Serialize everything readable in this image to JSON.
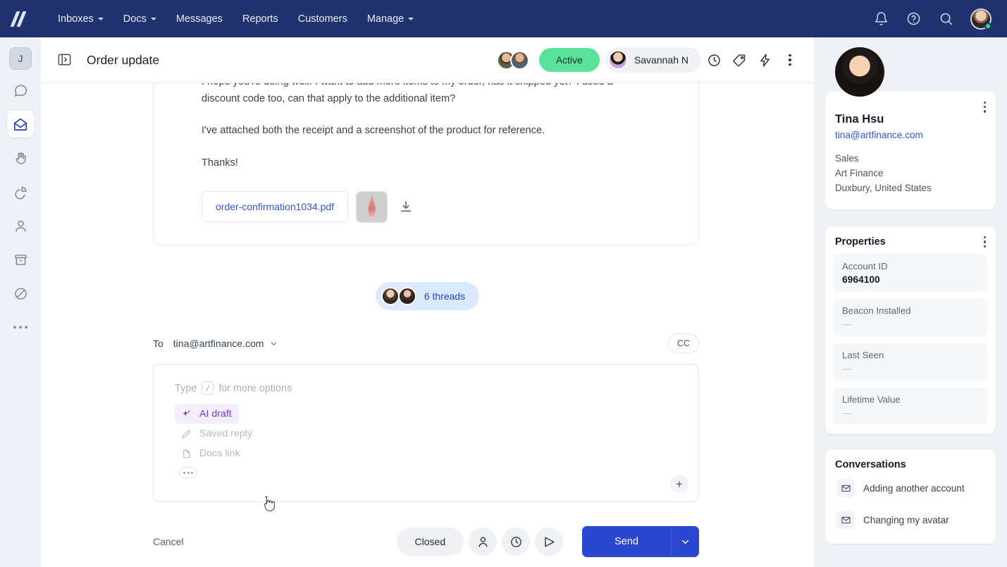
{
  "topnav": {
    "logo": "helpscout-logo",
    "items": [
      {
        "label": "Inboxes",
        "caret": true
      },
      {
        "label": "Docs",
        "caret": true
      },
      {
        "label": "Messages",
        "caret": false
      },
      {
        "label": "Reports",
        "caret": false
      },
      {
        "label": "Customers",
        "caret": false
      },
      {
        "label": "Manage",
        "caret": true
      }
    ],
    "icons": [
      "bell-icon",
      "help-circle-icon",
      "search-icon"
    ],
    "avatar_status": "online"
  },
  "rail": {
    "avatar_initial": "J",
    "items": [
      {
        "icon": "chat-bubble-icon",
        "active": false
      },
      {
        "icon": "open-envelope-icon",
        "active": true
      },
      {
        "icon": "raised-hand-icon",
        "active": false
      },
      {
        "icon": "pie-chart-icon",
        "active": false
      },
      {
        "icon": "person-icon",
        "active": false
      },
      {
        "icon": "archive-box-icon",
        "active": false
      },
      {
        "icon": "circle-slash-icon",
        "active": false
      }
    ],
    "more": "more-icon"
  },
  "subheader": {
    "toggle_icon": "panel-toggle-icon",
    "title": "Order update",
    "status_label": "Active",
    "assignee": "Savannah N",
    "icons": [
      "clock-icon",
      "tag-icon",
      "lightning-icon",
      "kebab-icon"
    ]
  },
  "message": {
    "paragraphs": [
      "I hope you're doing well. I want to add more items to my order, has it shipped yet? I used a discount code too, can that apply to the additional item?",
      "I've attached both the receipt and a screenshot of the product for reference.",
      "Thanks!"
    ],
    "attachment_name": "order-confirmation1034.pdf",
    "thumbnail": "product-screenshot-thumbnail",
    "download_icon": "download-icon"
  },
  "threads": {
    "label": "6 threads"
  },
  "compose": {
    "to_label": "To",
    "to_value": "tina@artfinance.com",
    "cc_label": "CC",
    "placeholder_prefix": "Type",
    "placeholder_key": "/",
    "placeholder_suffix": "for more options",
    "options": [
      {
        "label": "AI draft",
        "icon": "sparkle-icon",
        "highlighted": true
      },
      {
        "label": "Saved reply",
        "icon": "pen-icon",
        "highlighted": false
      },
      {
        "label": "Docs link",
        "icon": "document-icon",
        "highlighted": false
      }
    ],
    "more_icon": "ellipsis-icon",
    "add_icon": "plus-icon"
  },
  "footer": {
    "cancel_label": "Cancel",
    "status_label": "Closed",
    "icons": [
      "assignee-icon",
      "snooze-clock-icon",
      "send-later-icon"
    ],
    "send_label": "Send",
    "send_caret": "chevron-down-icon"
  },
  "sidebar": {
    "contact": {
      "name": "Tina Hsu",
      "email": "tina@artfinance.com",
      "role": "Sales",
      "company": "Art Finance",
      "location": "Duxbury, United States"
    },
    "properties_title": "Properties",
    "properties": [
      {
        "key": "Account ID",
        "value": "6964100",
        "empty": false
      },
      {
        "key": "Beacon Installed",
        "value": "—",
        "empty": true
      },
      {
        "key": "Last Seen",
        "value": "—",
        "empty": true
      },
      {
        "key": "Lifetime Value",
        "value": "—",
        "empty": true
      }
    ],
    "conversations_title": "Conversations",
    "conversations": [
      {
        "label": "Adding another account",
        "icon": "envelope-icon"
      },
      {
        "label": "Changing my avatar",
        "icon": "envelope-icon"
      }
    ]
  },
  "colors": {
    "nav_bg": "#21336f",
    "accent_blue": "#2c47cf",
    "link_blue": "#2f55d4",
    "active_green": "#5ae29a",
    "ai_purple": "#7a3fc4",
    "rail_bg": "#eef1f6"
  }
}
